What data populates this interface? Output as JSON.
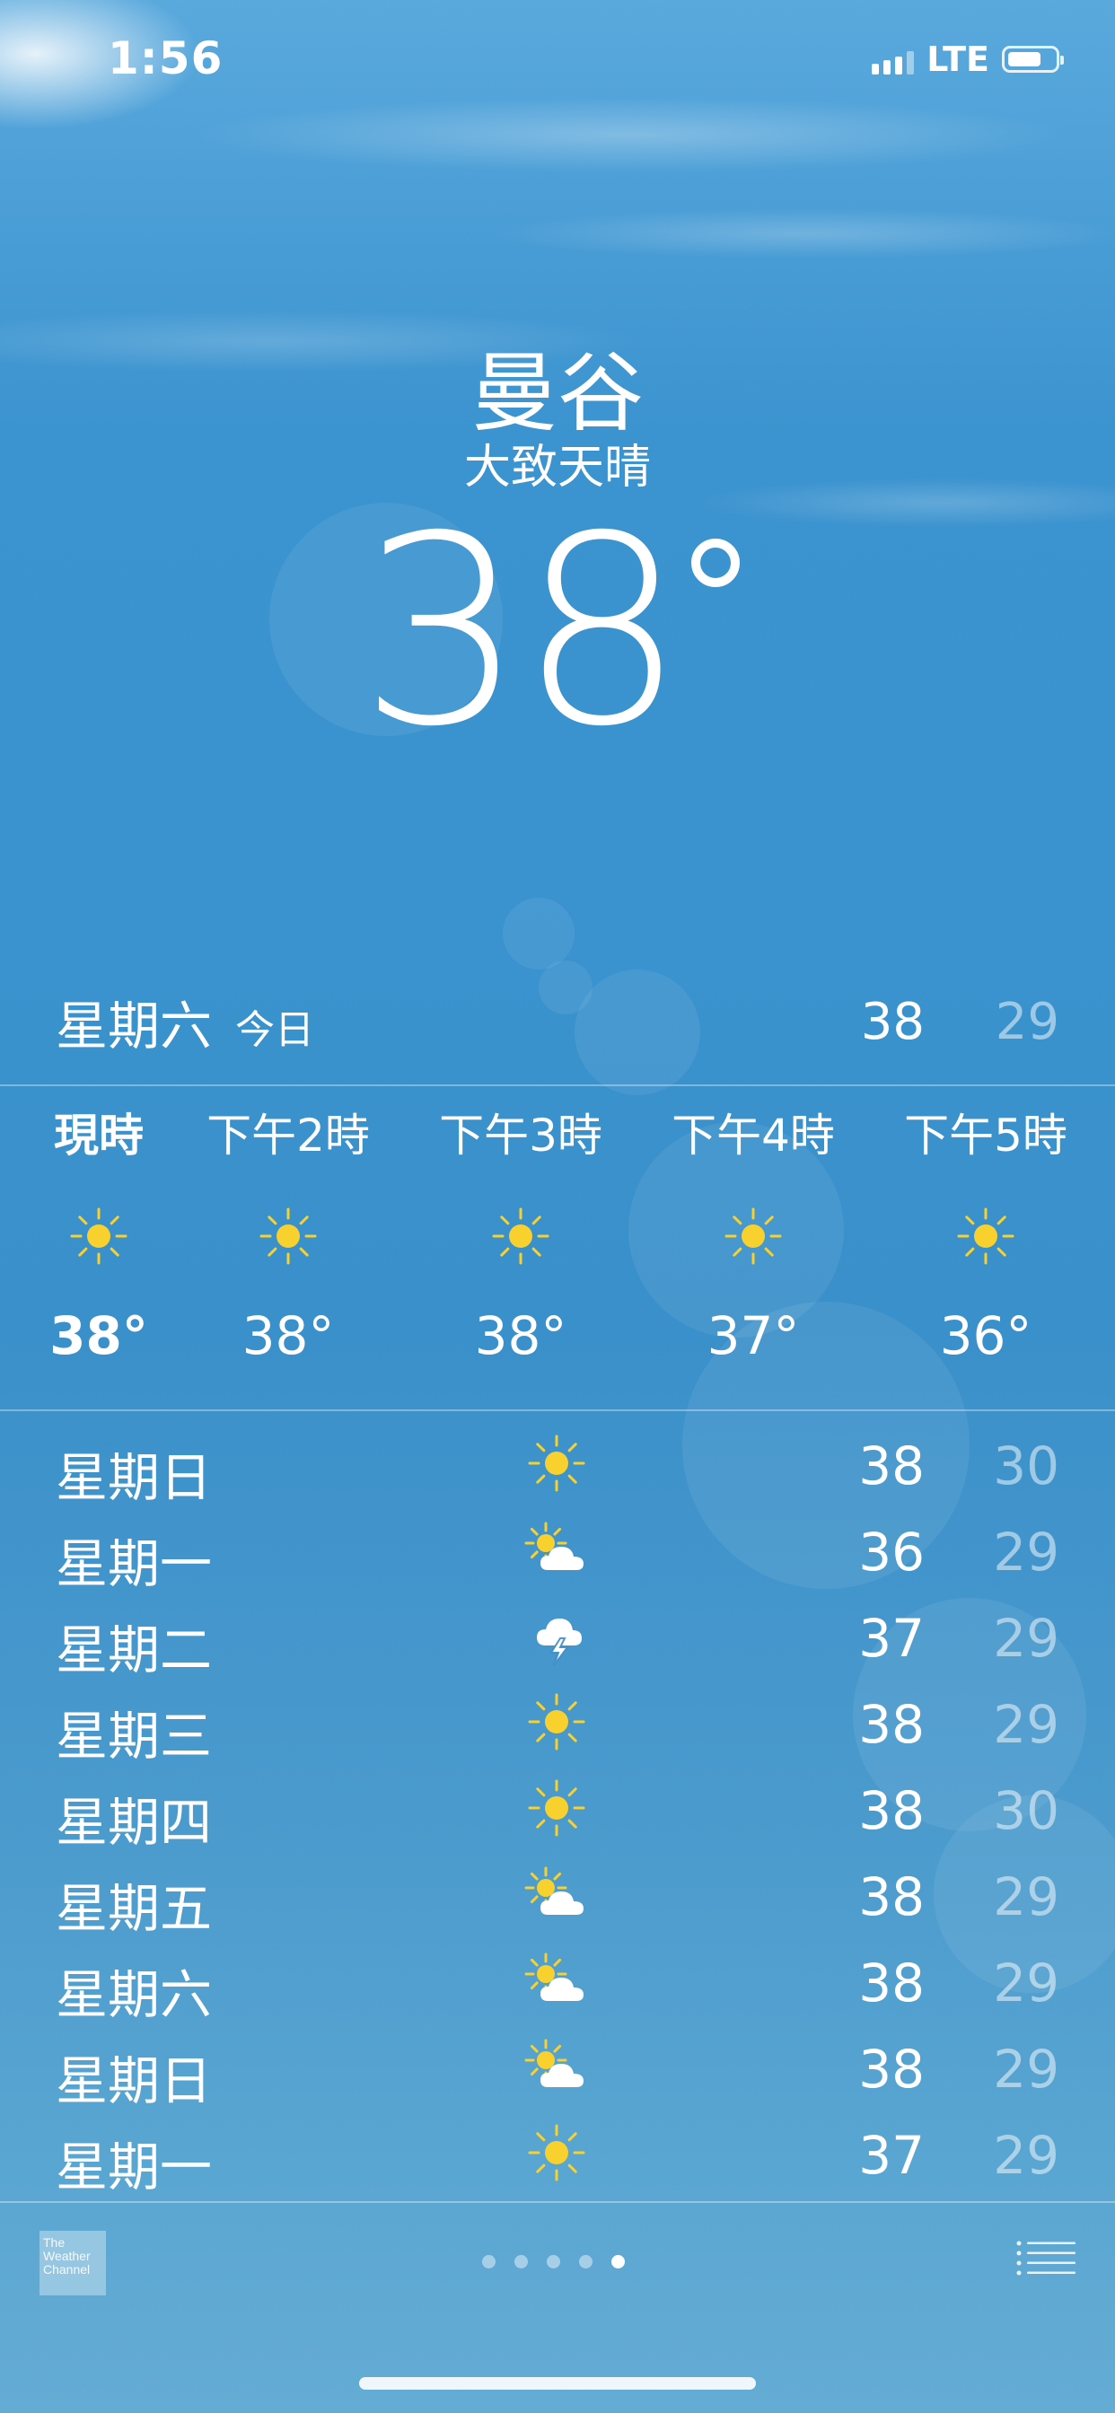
{
  "status_bar": {
    "time": "1:56",
    "network": "LTE"
  },
  "header": {
    "city": "曼谷",
    "condition": "大致天晴",
    "temperature": "38"
  },
  "today": {
    "day": "星期六",
    "label": "今日",
    "high": "38",
    "low": "29"
  },
  "hourly": [
    {
      "label": "現時",
      "icon": "sun-icon",
      "temp": "38°"
    },
    {
      "label": "下午2時",
      "icon": "sun-icon",
      "temp": "38°"
    },
    {
      "label": "下午3時",
      "icon": "sun-icon",
      "temp": "38°"
    },
    {
      "label": "下午4時",
      "icon": "sun-icon",
      "temp": "37°"
    },
    {
      "label": "下午5時",
      "icon": "sun-icon",
      "temp": "36°"
    }
  ],
  "daily": [
    {
      "day": "星期日",
      "icon": "sun-icon",
      "high": "38",
      "low": "30"
    },
    {
      "day": "星期一",
      "icon": "partly-cloudy-icon",
      "high": "36",
      "low": "29"
    },
    {
      "day": "星期二",
      "icon": "thunderstorm-icon",
      "high": "37",
      "low": "29"
    },
    {
      "day": "星期三",
      "icon": "sun-icon",
      "high": "38",
      "low": "29"
    },
    {
      "day": "星期四",
      "icon": "sun-icon",
      "high": "38",
      "low": "30"
    },
    {
      "day": "星期五",
      "icon": "partly-cloudy-icon",
      "high": "38",
      "low": "29"
    },
    {
      "day": "星期六",
      "icon": "partly-cloudy-icon",
      "high": "38",
      "low": "29"
    },
    {
      "day": "星期日",
      "icon": "partly-cloudy-icon",
      "high": "38",
      "low": "29"
    },
    {
      "day": "星期一",
      "icon": "sun-icon",
      "high": "37",
      "low": "29"
    }
  ],
  "footer": {
    "logo_text": "The Weather Channel",
    "pages": 5,
    "active_page": 5
  },
  "colors": {
    "sun": "#f8d12e",
    "low_temp": "rgba(255,255,255,0.5)"
  }
}
